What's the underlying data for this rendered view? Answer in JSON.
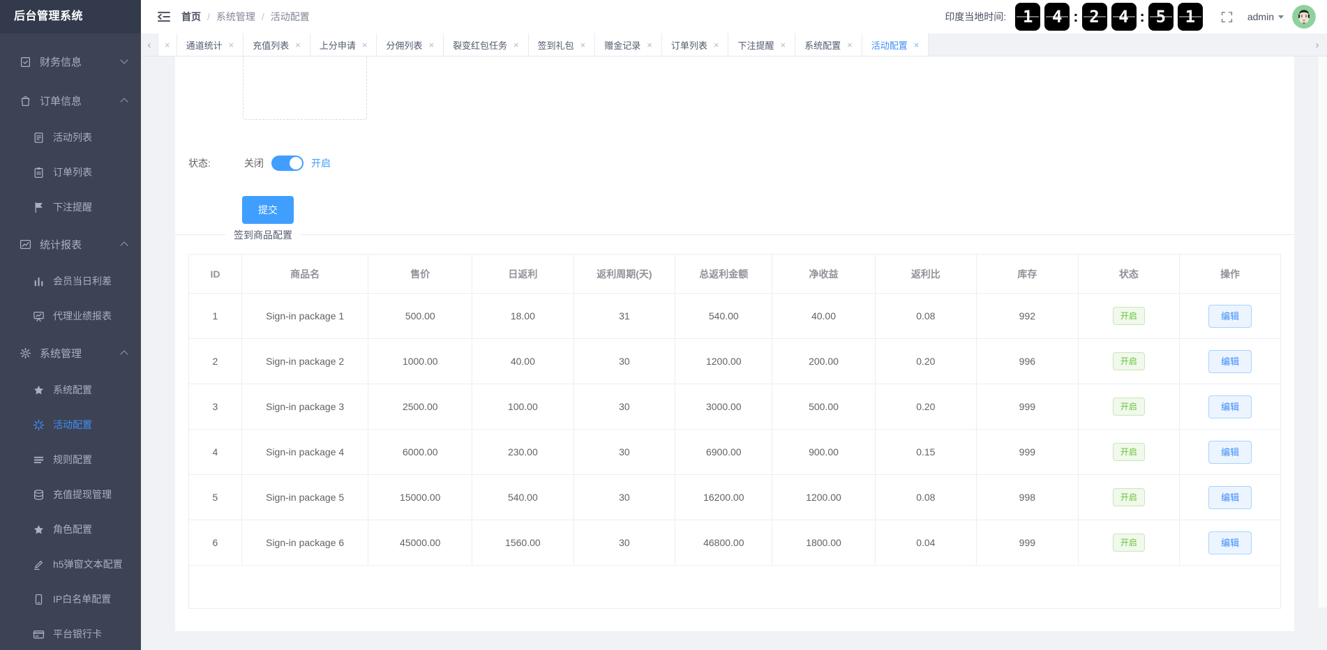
{
  "app": {
    "title": "后台管理系统"
  },
  "header": {
    "breadcrumb": {
      "items": [
        "首页",
        "系统管理",
        "活动配置"
      ],
      "separator": "/"
    },
    "clock": {
      "label": "印度当地时间:",
      "digits": [
        "1",
        "4",
        "2",
        "4",
        "5",
        "1"
      ],
      "colon": ":"
    },
    "user": {
      "name": "admin"
    }
  },
  "sidebar": {
    "items": [
      {
        "slug": "finance-info",
        "label": "财务信息",
        "icon": "clipboard-check-icon",
        "level": 1,
        "chevron": "down"
      },
      {
        "slug": "order-info",
        "label": "订单信息",
        "icon": "shopping-bag-icon",
        "level": 1,
        "chevron": "up"
      },
      {
        "slug": "activity-list",
        "label": "活动列表",
        "icon": "document-icon",
        "level": 2
      },
      {
        "slug": "order-list",
        "label": "订单列表",
        "icon": "clipboard-icon",
        "level": 2
      },
      {
        "slug": "bet-reminder",
        "label": "下注提醒",
        "icon": "flag-icon",
        "level": 2
      },
      {
        "slug": "stats-report",
        "label": "统计报表",
        "icon": "trend-chart-icon",
        "level": 1,
        "chevron": "up"
      },
      {
        "slug": "member-daily-spread",
        "label": "会员当日利差",
        "icon": "bar-chart-icon",
        "level": 2
      },
      {
        "slug": "agent-performance-report",
        "label": "代理业绩报表",
        "icon": "presentation-chart-icon",
        "level": 2
      },
      {
        "slug": "system-management",
        "label": "系统管理",
        "icon": "gear-icon",
        "level": 1,
        "chevron": "up"
      },
      {
        "slug": "system-config",
        "label": "系统配置",
        "icon": "star-icon",
        "level": 2
      },
      {
        "slug": "activity-config",
        "label": "活动配置",
        "icon": "spark-icon",
        "level": 2,
        "active": true
      },
      {
        "slug": "rule-config",
        "label": "规则配置",
        "icon": "list-icon",
        "level": 2
      },
      {
        "slug": "recharge-withdraw-management",
        "label": "充值提现管理",
        "icon": "database-icon",
        "level": 2
      },
      {
        "slug": "role-config",
        "label": "角色配置",
        "icon": "star-icon",
        "level": 2
      },
      {
        "slug": "h5-popup-text-config",
        "label": "h5弹窗文本配置",
        "icon": "pen-icon",
        "level": 2
      },
      {
        "slug": "ip-whitelist-config",
        "label": "IP白名单配置",
        "icon": "mobile-icon",
        "level": 2
      },
      {
        "slug": "platform-bank-card",
        "label": "平台银行卡",
        "icon": "bank-card-icon",
        "level": 2
      }
    ]
  },
  "tabs": {
    "close_glyph": "×",
    "left_arrow": "‹",
    "right_arrow": "›",
    "items": [
      {
        "slug": "channel-stats",
        "label": "通道统计"
      },
      {
        "slug": "recharge-list",
        "label": "充值列表"
      },
      {
        "slug": "score-up-request",
        "label": "上分申请"
      },
      {
        "slug": "commission-list",
        "label": "分佣列表"
      },
      {
        "slug": "fission-red-packet-task",
        "label": "裂变红包任务"
      },
      {
        "slug": "signin-gift",
        "label": "签到礼包"
      },
      {
        "slug": "bonus-record",
        "label": "赠金记录"
      },
      {
        "slug": "order-list",
        "label": "订单列表"
      },
      {
        "slug": "bet-reminder",
        "label": "下注提醒"
      },
      {
        "slug": "system-config",
        "label": "系统配置"
      },
      {
        "slug": "activity-config",
        "label": "活动配置",
        "active": true
      }
    ]
  },
  "form": {
    "status_label": "状态:",
    "off_label": "关闭",
    "on_label": "开启",
    "toggle_state": "on",
    "submit_label": "提交"
  },
  "section": {
    "title": "签到商品配置"
  },
  "table": {
    "columns": [
      "ID",
      "商品名",
      "售价",
      "日返利",
      "返利周期(天)",
      "总返利金额",
      "净收益",
      "返利比",
      "库存",
      "状态",
      "操作"
    ],
    "rows": [
      {
        "id": "1",
        "name": "Sign-in package 1",
        "price": "500.00",
        "daily_rebate": "18.00",
        "period_days": "31",
        "total_rebate": "540.00",
        "net_profit": "40.00",
        "rebate_ratio": "0.08",
        "stock": "992",
        "status": "开启",
        "action": "编辑"
      },
      {
        "id": "2",
        "name": "Sign-in package 2",
        "price": "1000.00",
        "daily_rebate": "40.00",
        "period_days": "30",
        "total_rebate": "1200.00",
        "net_profit": "200.00",
        "rebate_ratio": "0.20",
        "stock": "996",
        "status": "开启",
        "action": "编辑"
      },
      {
        "id": "3",
        "name": "Sign-in package 3",
        "price": "2500.00",
        "daily_rebate": "100.00",
        "period_days": "30",
        "total_rebate": "3000.00",
        "net_profit": "500.00",
        "rebate_ratio": "0.20",
        "stock": "999",
        "status": "开启",
        "action": "编辑"
      },
      {
        "id": "4",
        "name": "Sign-in package 4",
        "price": "6000.00",
        "daily_rebate": "230.00",
        "period_days": "30",
        "total_rebate": "6900.00",
        "net_profit": "900.00",
        "rebate_ratio": "0.15",
        "stock": "999",
        "status": "开启",
        "action": "编辑"
      },
      {
        "id": "5",
        "name": "Sign-in package 5",
        "price": "15000.00",
        "daily_rebate": "540.00",
        "period_days": "30",
        "total_rebate": "16200.00",
        "net_profit": "1200.00",
        "rebate_ratio": "0.08",
        "stock": "998",
        "status": "开启",
        "action": "编辑"
      },
      {
        "id": "6",
        "name": "Sign-in package 6",
        "price": "45000.00",
        "daily_rebate": "1560.00",
        "period_days": "30",
        "total_rebate": "46800.00",
        "net_profit": "1800.00",
        "rebate_ratio": "0.04",
        "stock": "999",
        "status": "开启",
        "action": "编辑"
      }
    ]
  },
  "colors": {
    "primary": "#409eff",
    "active_menu": "#3f8df9",
    "success_text": "#67c23a",
    "success_bg": "#f0f9eb",
    "sidebar_bg": "#3d4354",
    "clock_bg": "#000000",
    "avatar_bg": "#8fd19e",
    "page_bg": "#f0f2f5"
  }
}
